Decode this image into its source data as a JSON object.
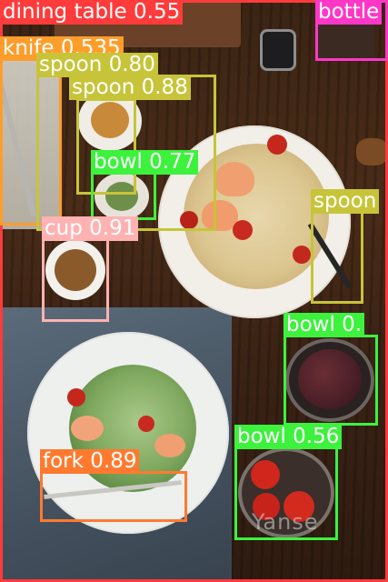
{
  "image": {
    "watermark": "Yanse"
  },
  "detections": [
    {
      "label": "dining table 0.55",
      "color": "#ff3b3b"
    },
    {
      "label": "bottle",
      "color": "#ff37c7"
    },
    {
      "label": "knife 0.535",
      "color": "#ff9d2b"
    },
    {
      "label": "spoon 0.80",
      "color": "#c7c43a"
    },
    {
      "label": "spoon 0.88",
      "color": "#c7c43a"
    },
    {
      "label": "bowl 0.77",
      "color": "#3cf23c"
    },
    {
      "label": "spoon",
      "color": "#c7c43a"
    },
    {
      "label": "cup 0.91",
      "color": "#ffb2b2"
    },
    {
      "label": "bowl 0.",
      "color": "#3cf23c"
    },
    {
      "label": "bowl 0.56",
      "color": "#3cf23c"
    },
    {
      "label": "fork 0.89",
      "color": "#ff7a2f"
    }
  ]
}
